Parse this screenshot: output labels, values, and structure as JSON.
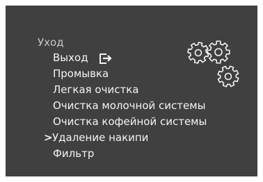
{
  "menu": {
    "title": "Уход",
    "items": [
      {
        "label": "Выход",
        "icon": "exit-icon"
      },
      {
        "label": "Промывка"
      },
      {
        "label": "Легкая очистка"
      },
      {
        "label": "Очистка молочной системы"
      },
      {
        "label": "Очистка кофейной системы"
      },
      {
        "label": "Удаление накипи",
        "selected": true
      },
      {
        "label": "Фильтр"
      }
    ],
    "cursor_symbol": ">"
  },
  "decoration": {
    "icon": "gears-icon"
  },
  "colors": {
    "background": "#404040",
    "title_text": "#c9c9c9",
    "item_text": "#f4f4f4",
    "icon_stroke": "#f4f4f4"
  }
}
